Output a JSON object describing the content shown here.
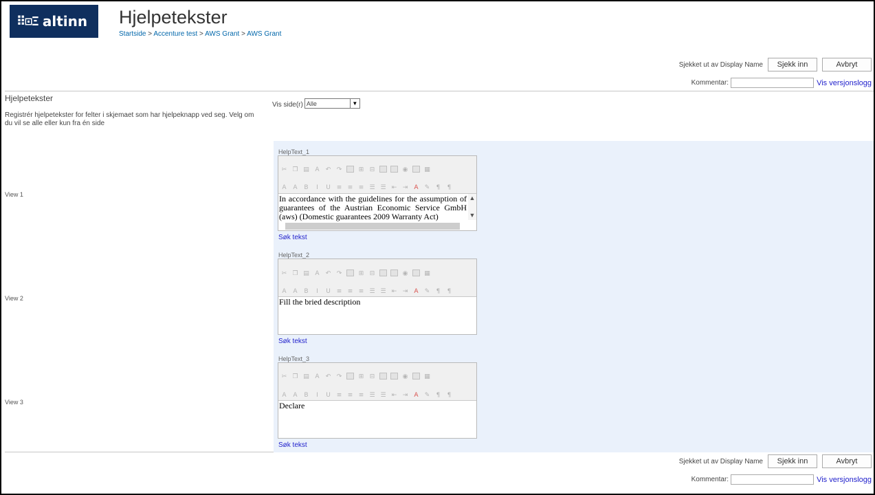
{
  "brand": {
    "logo_mark": "::␣⊐",
    "logo_text": "altinn"
  },
  "header": {
    "title": "Hjelpetekster",
    "breadcrumb": [
      "Startside",
      "Accenture test",
      "AWS Grant",
      "AWS Grant"
    ],
    "separator": ">"
  },
  "checkin": {
    "checked_out_by": "Sjekket ut av Display Name",
    "checkin_label": "Sjekk inn",
    "cancel_label": "Avbryt",
    "comment_label": "Kommentar:",
    "comment_value": "",
    "version_link": "Vis versjonslogg"
  },
  "section": {
    "title": "Hjelpetekster",
    "description": "Registrér hjelpetekster for felter i skjemaet som har hjelpeknapp ved seg. Velg om du vil se alle eller kun fra én side"
  },
  "filter": {
    "label": "Vis side(r)",
    "selected": "Alle"
  },
  "views": [
    {
      "label": "View 1",
      "field": "HelpText_1",
      "content": "In accordance with the guidelines for the assumption of guarantees of the Austrian Economic Service GmbH (aws) (Domestic guarantees 2009 Warranty Act)",
      "search_link": "Søk tekst"
    },
    {
      "label": "View 2",
      "field": "HelpText_2",
      "content": "Fill the bried description",
      "search_link": "Søk tekst"
    },
    {
      "label": "View 3",
      "field": "HelpText_3",
      "content": "Declare",
      "search_link": "Søk tekst"
    }
  ],
  "toolbar_icons": {
    "row1": [
      "cut-icon",
      "copy-icon",
      "paste-icon",
      "spellcheck-icon",
      "undo-icon",
      "redo-icon",
      "table-icon",
      "insert-icon",
      "style-icon",
      "image-icon",
      "link-icon",
      "media-icon",
      "html-icon",
      "source-icon"
    ],
    "row2": [
      "font-icon",
      "font-size-icon",
      "bold-icon",
      "italic-icon",
      "underline-icon",
      "align-left-icon",
      "align-center-icon",
      "align-right-icon",
      "numbered-list-icon",
      "bullet-list-icon",
      "outdent-icon",
      "indent-icon",
      "font-color-icon",
      "highlight-icon",
      "ltr-icon",
      "rtl-icon"
    ]
  }
}
